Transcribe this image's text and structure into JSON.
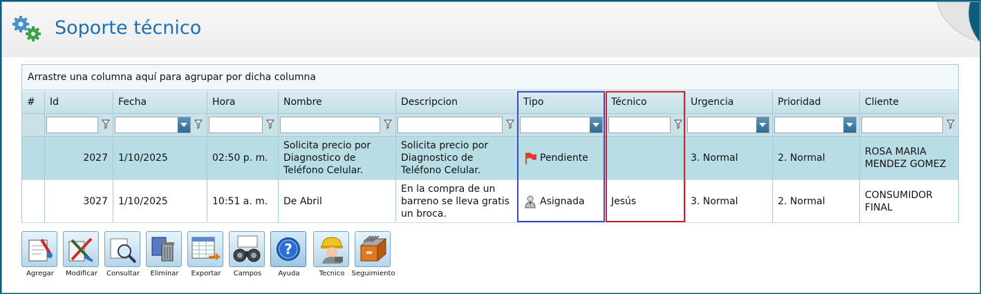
{
  "title": "Soporte técnico",
  "group_bar_text": "Arrastre una columna aquí para agrupar por dicha columna",
  "columns": [
    "#",
    "Id",
    "Fecha",
    "Hora",
    "Nombre",
    "Descripcion",
    "Tipo",
    "Técnico",
    "Urgencia",
    "Prioridad",
    "Cliente"
  ],
  "rows": [
    {
      "id": "2027",
      "fecha": "1/10/2025",
      "hora": "02:50 p. m.",
      "nombre": "Solicita precio por Diagnostico de Teléfono Celular.",
      "descripcion": "Solicita precio por Diagnostico de Teléfono Celular.",
      "tipo": "Pendiente",
      "tipo_icon": "red-flag-icon",
      "tecnico": "",
      "urgencia": "3. Normal",
      "prioridad": "2. Normal",
      "cliente": "ROSA MARIA MENDEZ GOMEZ"
    },
    {
      "id": "3027",
      "fecha": "1/10/2025",
      "hora": "10:51 a. m.",
      "nombre": "De Abril",
      "descripcion": "En la compra de un barreno se lleva gratis un broca.",
      "tipo": "Asignada",
      "tipo_icon": "assigned-user-icon",
      "tecnico": "Jesús",
      "urgencia": "3. Normal",
      "prioridad": "2. Normal",
      "cliente": "CONSUMIDOR FINAL"
    }
  ],
  "toolbar": [
    {
      "label": "Agregar",
      "icon": "add-document-icon"
    },
    {
      "label": "Modificar",
      "icon": "edit-tools-icon"
    },
    {
      "label": "Consultar",
      "icon": "search-document-icon"
    },
    {
      "label": "Eliminar",
      "icon": "trash-icon"
    },
    {
      "label": "Exportar",
      "icon": "export-spreadsheet-icon"
    },
    {
      "label": "Campos",
      "icon": "binoculars-icon"
    },
    {
      "label": "Ayuda",
      "icon": "help-icon"
    },
    {
      "label": "Tecnico",
      "icon": "technician-icon"
    },
    {
      "label": "Seguimiento",
      "icon": "file-cabinet-icon"
    }
  ],
  "colors": {
    "title": "#1c6fb0",
    "row_selected": "#b9dde4",
    "header_bg": "#c4e0e8",
    "highlight_blue": "#3a48c2",
    "highlight_red": "#d0202a"
  }
}
